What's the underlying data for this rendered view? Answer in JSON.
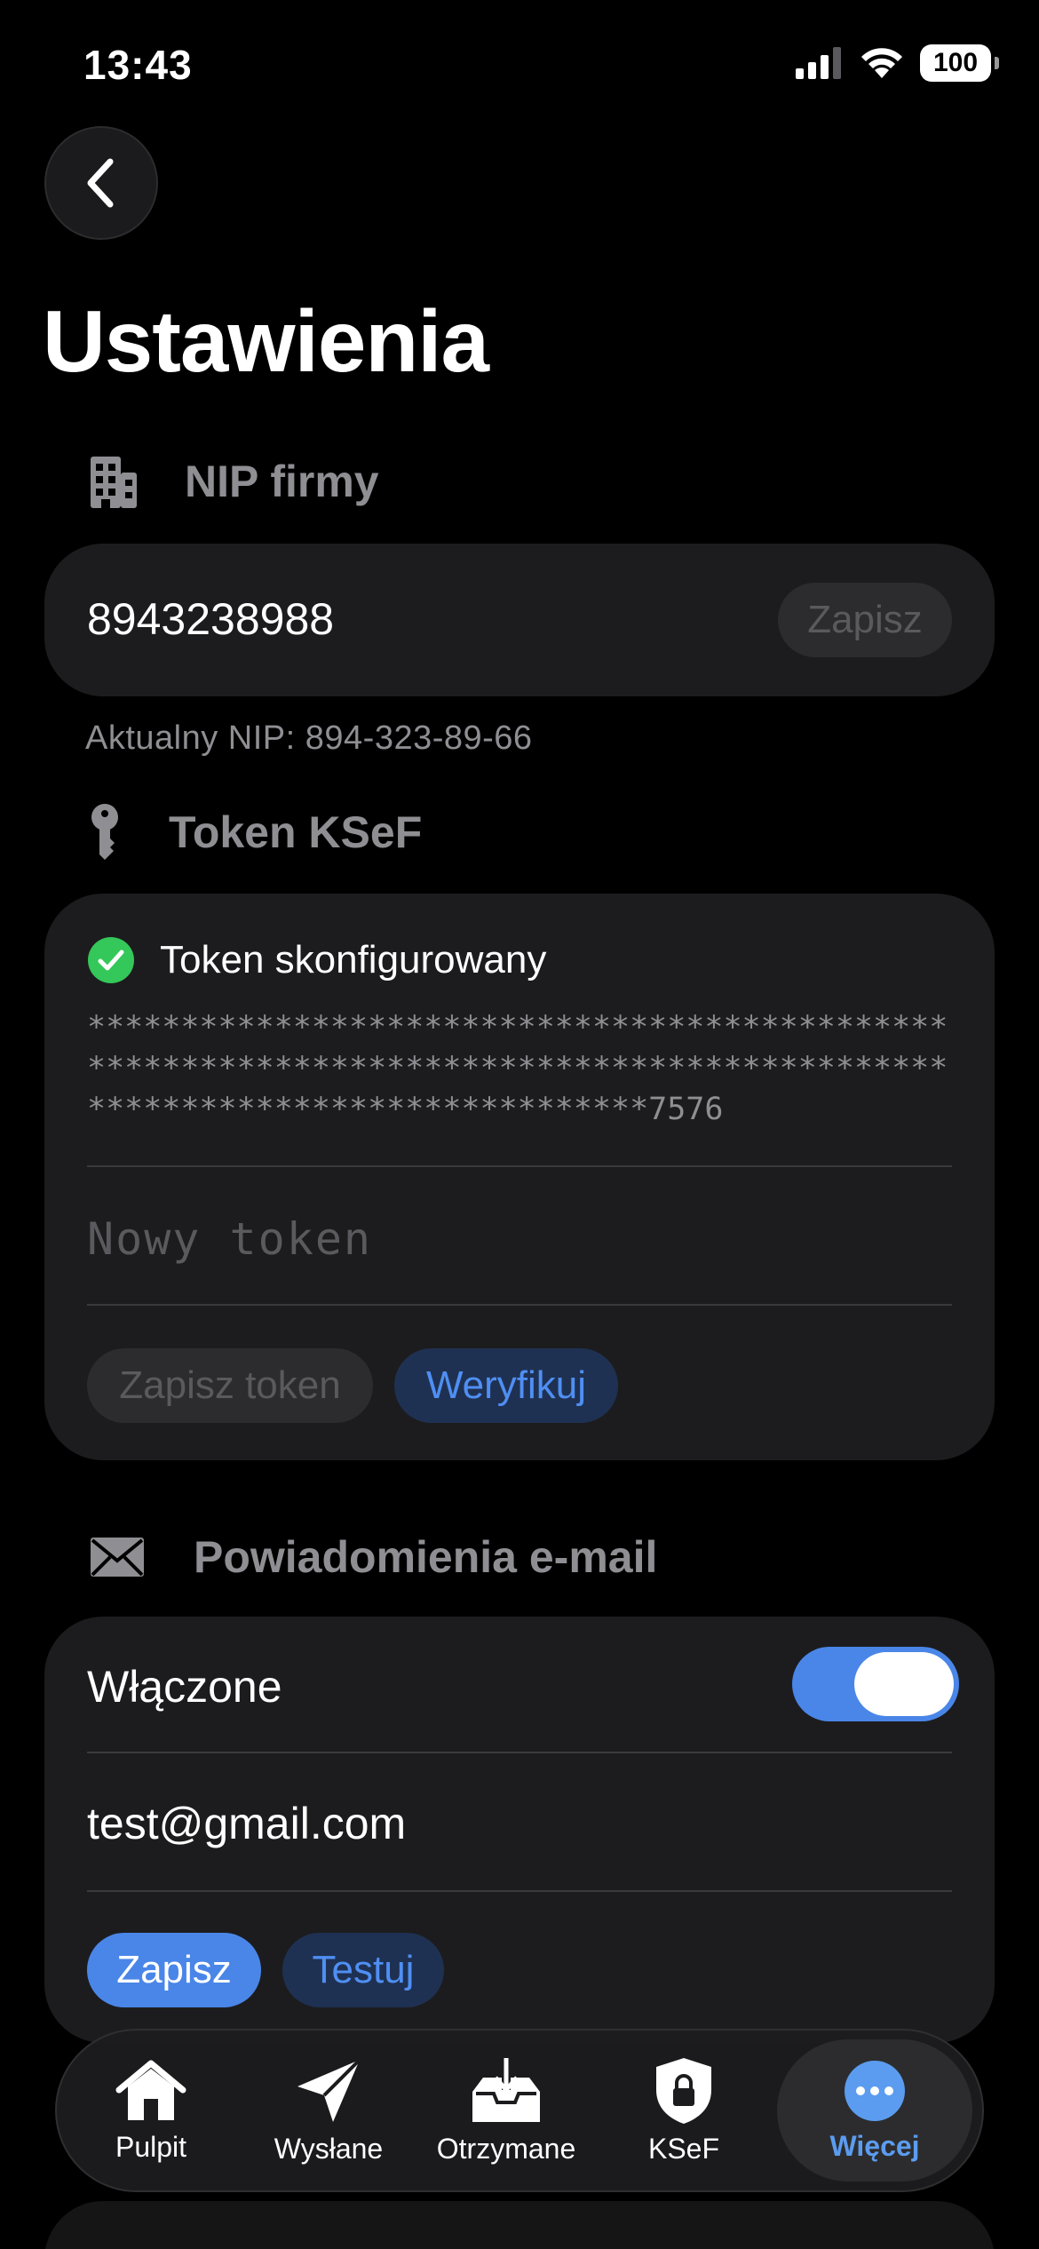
{
  "status_bar": {
    "time": "13:43",
    "battery": "100",
    "signal_icon": "cellular-signal-icon",
    "wifi_icon": "wifi-icon"
  },
  "nav": {
    "back_icon": "chevron-left-icon"
  },
  "page": {
    "title": "Ustawienia"
  },
  "nip_section": {
    "header": "NIP firmy",
    "icon": "building-icon",
    "value": "8943238988",
    "save_label": "Zapisz",
    "hint": "Aktualny NIP: 894-323-89-66"
  },
  "token_section": {
    "header": "Token KSeF",
    "icon": "key-icon",
    "status": "Token skonfigurowany",
    "status_icon": "checkmark-circle-icon",
    "masked_token": "**************************************************************************************************************************7576",
    "new_token_placeholder": "Nowy token",
    "save_token_label": "Zapisz token",
    "verify_label": "Weryfikuj"
  },
  "email_section": {
    "header": "Powiadomienia e-mail",
    "icon": "envelope-icon",
    "enabled_label": "Włączone",
    "enabled": true,
    "email": "test@gmail.com",
    "save_label": "Zapisz",
    "test_label": "Testuj"
  },
  "tab_bar": {
    "tabs": [
      {
        "label": "Pulpit",
        "icon": "house-icon"
      },
      {
        "label": "Wysłane",
        "icon": "paper-plane-icon"
      },
      {
        "label": "Otrzymane",
        "icon": "inbox-download-icon"
      },
      {
        "label": "KSeF",
        "icon": "lock-shield-icon"
      },
      {
        "label": "Więcej",
        "icon": "ellipsis-circle-icon",
        "active": true
      }
    ]
  },
  "colors": {
    "accent": "#4a86e8",
    "success": "#34c759",
    "card": "#1c1c1e",
    "background": "#000000"
  }
}
